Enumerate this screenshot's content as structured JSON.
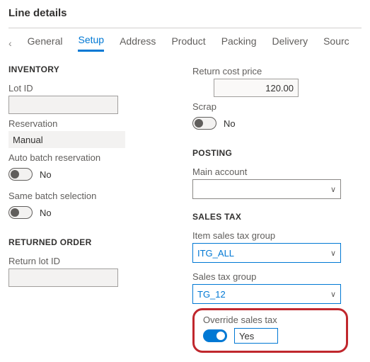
{
  "title": "Line details",
  "tabs": {
    "items": [
      "General",
      "Setup",
      "Address",
      "Product",
      "Packing",
      "Delivery",
      "Sourc"
    ],
    "active": "Setup"
  },
  "left": {
    "inventory": {
      "heading": "INVENTORY",
      "lot_id": {
        "label": "Lot ID",
        "value": ""
      },
      "reservation": {
        "label": "Reservation",
        "value": "Manual"
      },
      "auto_batch": {
        "label": "Auto batch reservation",
        "value_text": "No",
        "on": false
      },
      "same_batch": {
        "label": "Same batch selection",
        "value_text": "No",
        "on": false
      }
    },
    "returned_order": {
      "heading": "RETURNED ORDER",
      "return_lot_id": {
        "label": "Return lot ID",
        "value": ""
      }
    }
  },
  "right": {
    "return_cost": {
      "label": "Return cost price",
      "value": "120.00"
    },
    "scrap": {
      "label": "Scrap",
      "value_text": "No",
      "on": false
    },
    "posting": {
      "heading": "POSTING",
      "main_account": {
        "label": "Main account",
        "value": ""
      }
    },
    "sales_tax": {
      "heading": "SALES TAX",
      "item_group": {
        "label": "Item sales tax group",
        "value": "ITG_ALL"
      },
      "group": {
        "label": "Sales tax group",
        "value": "TG_12"
      },
      "override": {
        "label": "Override sales tax",
        "value_text": "Yes",
        "on": true
      }
    }
  }
}
